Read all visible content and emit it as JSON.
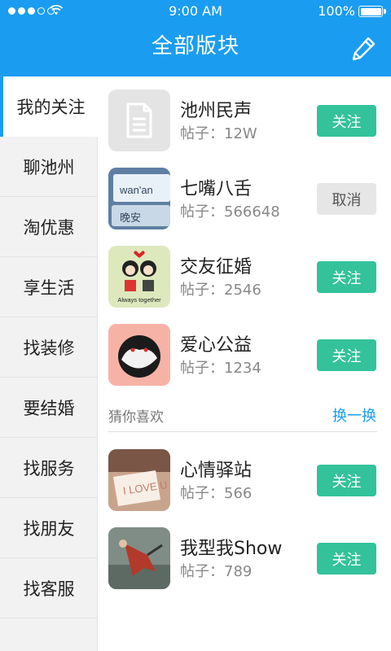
{
  "status_bar": {
    "time": "9:00 AM",
    "battery": "100%"
  },
  "header": {
    "title": "全部版块",
    "edit_icon": "pencil-icon"
  },
  "sidebar": {
    "items": [
      {
        "label": "我的关注",
        "active": true
      },
      {
        "label": "聊池州"
      },
      {
        "label": "淘优惠"
      },
      {
        "label": "享生活"
      },
      {
        "label": "找装修"
      },
      {
        "label": "要结婚"
      },
      {
        "label": "找服务"
      },
      {
        "label": "找朋友"
      },
      {
        "label": "找客服"
      }
    ]
  },
  "followed": [
    {
      "name": "池州民声",
      "posts": "帖子：12W",
      "action": "关注",
      "state": "follow"
    },
    {
      "name": "七嘴八舌",
      "posts": "帖子：566648",
      "action": "取消",
      "state": "cancel"
    },
    {
      "name": "交友征婚",
      "posts": "帖子：2546",
      "action": "关注",
      "state": "follow"
    },
    {
      "name": "爱心公益",
      "posts": "帖子：1234",
      "action": "关注",
      "state": "follow"
    }
  ],
  "recommend": {
    "title": "猜你喜欢",
    "refresh_label": "换一换",
    "items": [
      {
        "name": "心情驿站",
        "posts": "帖子：566",
        "action": "关注",
        "state": "follow"
      },
      {
        "name": "我型我Show",
        "posts": "帖子：789",
        "action": "关注",
        "state": "follow"
      }
    ]
  },
  "thumb_text": {
    "keyboard_word": "wan'an",
    "keyboard_candidate": "晚安",
    "couple_caption": "Always together",
    "card_text": "I LOVE U"
  },
  "colors": {
    "header_blue": "#1a9df0",
    "follow_green": "#33c29a",
    "cancel_gray": "#e6e6e6"
  }
}
